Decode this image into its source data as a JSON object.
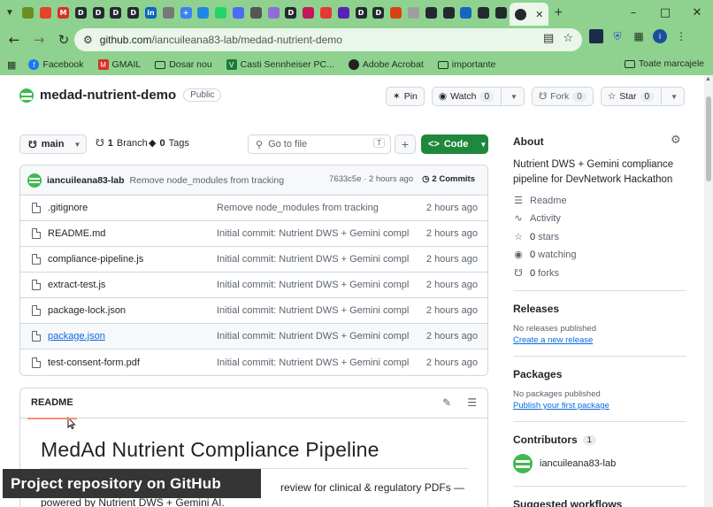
{
  "browser": {
    "url_host": "github.com",
    "url_path": "/iancuileana83-lab/medad-nutrient-demo",
    "tab_favicons": [
      {
        "letter": "",
        "color": "#6b8e23"
      },
      {
        "letter": "",
        "color": "#e24329"
      },
      {
        "letter": "M",
        "color": "#d93025"
      },
      {
        "letter": "D",
        "color": "#24292f"
      },
      {
        "letter": "D",
        "color": "#24292f"
      },
      {
        "letter": "D",
        "color": "#24292f"
      },
      {
        "letter": "D",
        "color": "#24292f"
      },
      {
        "letter": "in",
        "color": "#0a66c2"
      },
      {
        "letter": "",
        "color": "#777777"
      },
      {
        "letter": "+",
        "color": "#3b82f6"
      },
      {
        "letter": "",
        "color": "#1e88e5"
      },
      {
        "letter": "",
        "color": "#25d366"
      },
      {
        "letter": "",
        "color": "#4a6cf7"
      },
      {
        "letter": "",
        "color": "#555555"
      },
      {
        "letter": "",
        "color": "#8e6dd8"
      },
      {
        "letter": "D",
        "color": "#24292f"
      },
      {
        "letter": "",
        "color": "#c2185b"
      },
      {
        "letter": "",
        "color": "#e53935"
      },
      {
        "letter": "",
        "color": "#5b21b6"
      },
      {
        "letter": "D",
        "color": "#24292f"
      },
      {
        "letter": "D",
        "color": "#24292f"
      },
      {
        "letter": "",
        "color": "#d84315"
      },
      {
        "letter": "",
        "color": "#9e9e9e"
      },
      {
        "letter": "",
        "color": "#24292f"
      },
      {
        "letter": "",
        "color": "#24292f"
      },
      {
        "letter": "",
        "color": "#1565c0"
      },
      {
        "letter": "",
        "color": "#24292f"
      },
      {
        "letter": "",
        "color": "#24292f"
      }
    ],
    "profile_letter": "i"
  },
  "bookmarks": {
    "items": [
      {
        "label": "Facebook",
        "icon_color": "#1877f2",
        "icon": "f"
      },
      {
        "label": "GMAIL",
        "icon_color": "#d93025",
        "icon": "M"
      },
      {
        "label": "Dosar nou",
        "icon_color": "",
        "icon": "folder"
      },
      {
        "label": "Casti Sennheiser PC...",
        "icon_color": "#1b7a3a",
        "icon": "V"
      },
      {
        "label": "Adobe Acrobat",
        "icon_color": "#222222",
        "icon": "globe"
      },
      {
        "label": "importante",
        "icon_color": "",
        "icon": "folder"
      }
    ],
    "all_bookmarks": "Toate marcajele"
  },
  "repo": {
    "name": "medad-nutrient-demo",
    "visibility": "Public",
    "pin_label": "Pin",
    "watch_label": "Watch",
    "watch_count": "0",
    "fork_label": "Fork",
    "fork_count": "0",
    "star_label": "Star",
    "star_count": "0"
  },
  "nav": {
    "branch": "main",
    "branches_count": "1",
    "branches_label": "Branch",
    "tags_count": "0",
    "tags_label": "Tags",
    "goto_placeholder": "Go to file",
    "goto_shortcut": "T",
    "code_label": "Code"
  },
  "commit": {
    "author": "iancuileana83-lab",
    "message": "Remove node_modules from tracking",
    "hash_time": "7633c5e · 2 hours ago",
    "commits_label": "2 Commits"
  },
  "files": [
    {
      "name": ".gitignore",
      "message": "Remove node_modules from tracking",
      "time": "2 hours ago"
    },
    {
      "name": "README.md",
      "message": "Initial commit: Nutrient DWS + Gemini compli...",
      "time": "2 hours ago"
    },
    {
      "name": "compliance-pipeline.js",
      "message": "Initial commit: Nutrient DWS + Gemini compli...",
      "time": "2 hours ago"
    },
    {
      "name": "extract-test.js",
      "message": "Initial commit: Nutrient DWS + Gemini compli...",
      "time": "2 hours ago"
    },
    {
      "name": "package-lock.json",
      "message": "Initial commit: Nutrient DWS + Gemini compli...",
      "time": "2 hours ago"
    },
    {
      "name": "package.json",
      "message": "Initial commit: Nutrient DWS + Gemini compli...",
      "time": "2 hours ago"
    },
    {
      "name": "test-consent-form.pdf",
      "message": "Initial commit: Nutrient DWS + Gemini compli...",
      "time": "2 hours ago"
    }
  ],
  "readme": {
    "tab_label": "README",
    "heading": "MedAd Nutrient Compliance Pipeline",
    "paragraph_end": "review for clinical & regulatory PDFs —",
    "paragraph_line2": "powered by Nutrient DWS + Gemini AI."
  },
  "about": {
    "title": "About",
    "description": "Nutrient DWS + Gemini compliance pipeline for DevNetwork Hackathon",
    "readme": "Readme",
    "activity": "Activity",
    "stars_count": "0",
    "stars_label": "stars",
    "watching_count": "0",
    "watching_label": "watching",
    "forks_count": "0",
    "forks_label": "forks"
  },
  "releases": {
    "title": "Releases",
    "empty": "No releases published",
    "link": "Create a new release"
  },
  "packages": {
    "title": "Packages",
    "empty": "No packages published",
    "link": "Publish your first package"
  },
  "contributors": {
    "title": "Contributors",
    "count": "1",
    "name": "iancuileana83-lab"
  },
  "cutoff_heading": "Suggested workflows",
  "caption": "Project repository on GitHub"
}
